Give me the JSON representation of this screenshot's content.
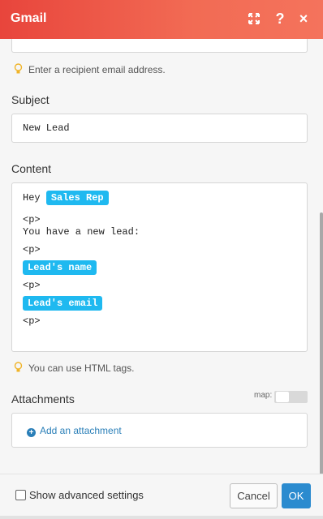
{
  "header": {
    "title": "Gmail",
    "expand_icon": "expand-icon",
    "help_label": "?",
    "close_label": "×"
  },
  "recipient": {
    "hint": "Enter a recipient email address."
  },
  "subject": {
    "label": "Subject",
    "value": "New Lead"
  },
  "content": {
    "label": "Content",
    "lines": [
      {
        "text": "Hey ",
        "pill": "Sales Rep"
      },
      {
        "text": "<p>"
      },
      {
        "text": "You have a new lead:"
      },
      {
        "text": "<p>"
      },
      {
        "pill": "Lead's name"
      },
      {
        "text": "<p>"
      },
      {
        "pill": "Lead's email"
      },
      {
        "text": "<p>"
      }
    ],
    "hint": "You can use HTML tags."
  },
  "attachments": {
    "label": "Attachments",
    "map_label": "map:",
    "add_label": "Add an attachment"
  },
  "footer": {
    "advanced_label": "Show advanced settings",
    "cancel_label": "Cancel",
    "ok_label": "OK"
  },
  "colors": {
    "header_start": "#e8453c",
    "header_end": "#f4735c",
    "pill": "#1fb9f0",
    "link": "#2a7fb8",
    "ok_button": "#2b8bcf"
  }
}
